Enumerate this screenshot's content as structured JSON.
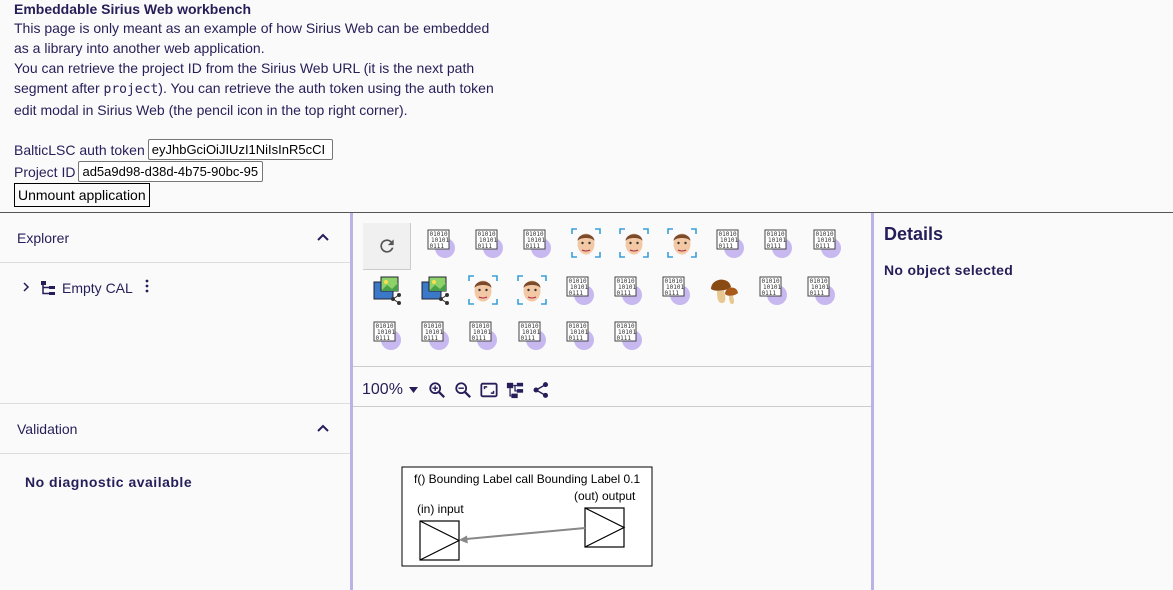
{
  "intro": {
    "title": "Embeddable Sirius Web workbench",
    "line1": "This page is only meant as an example of how Sirius Web can be embedded",
    "line2": "as a library into another web application.",
    "line3": "You can retrieve the project ID from the Sirius Web URL (it is the next path",
    "line4a": "segment after ",
    "line4code": "project",
    "line4b": "). You can retrieve the auth token using the auth token",
    "line5": "edit modal in Sirius Web (the pencil icon in the top right corner)."
  },
  "form": {
    "token_label": "BalticLSC auth token",
    "token_value": "eyJhbGciOiJIUzI1NiIsInR5cCI",
    "project_label": "Project ID",
    "project_value": "ad5a9d98-d38d-4b75-90bc-95",
    "unmount_label": "Unmount application"
  },
  "explorer": {
    "title": "Explorer",
    "tree": [
      {
        "label": "Empty CAL",
        "icon": "tree-structure-icon"
      }
    ]
  },
  "validation": {
    "title": "Validation",
    "empty_message": "No diagnostic available"
  },
  "palette": {
    "refresh_icon": "refresh-icon",
    "rows": [
      [
        "binary-data-icon",
        "binary-data-icon",
        "binary-data-icon",
        "face-icon",
        "face-icon",
        "face-icon",
        "binary-data-icon",
        "binary-data-icon",
        "binary-data-icon"
      ],
      [
        "image-share-icon",
        "image-share-icon",
        "face-icon",
        "face-icon",
        "binary-data-icon",
        "binary-data-icon",
        "binary-data-icon",
        "mushroom-icon",
        "binary-data-icon",
        "binary-data-icon"
      ],
      [
        "binary-data-icon",
        "binary-data-icon",
        "binary-data-icon",
        "binary-data-icon",
        "binary-data-icon",
        "binary-data-icon"
      ]
    ]
  },
  "toolbar": {
    "zoom": "100%",
    "icons": [
      "zoom-in-icon",
      "zoom-out-icon",
      "fit-to-screen-icon",
      "arrange-all-icon",
      "share-icon"
    ]
  },
  "diagram": {
    "node_title": "f() Bounding Label call Bounding Label 0.1",
    "input_label": "(in) input",
    "output_label": "(out) output"
  },
  "details": {
    "title": "Details",
    "empty_message": "No object selected"
  }
}
